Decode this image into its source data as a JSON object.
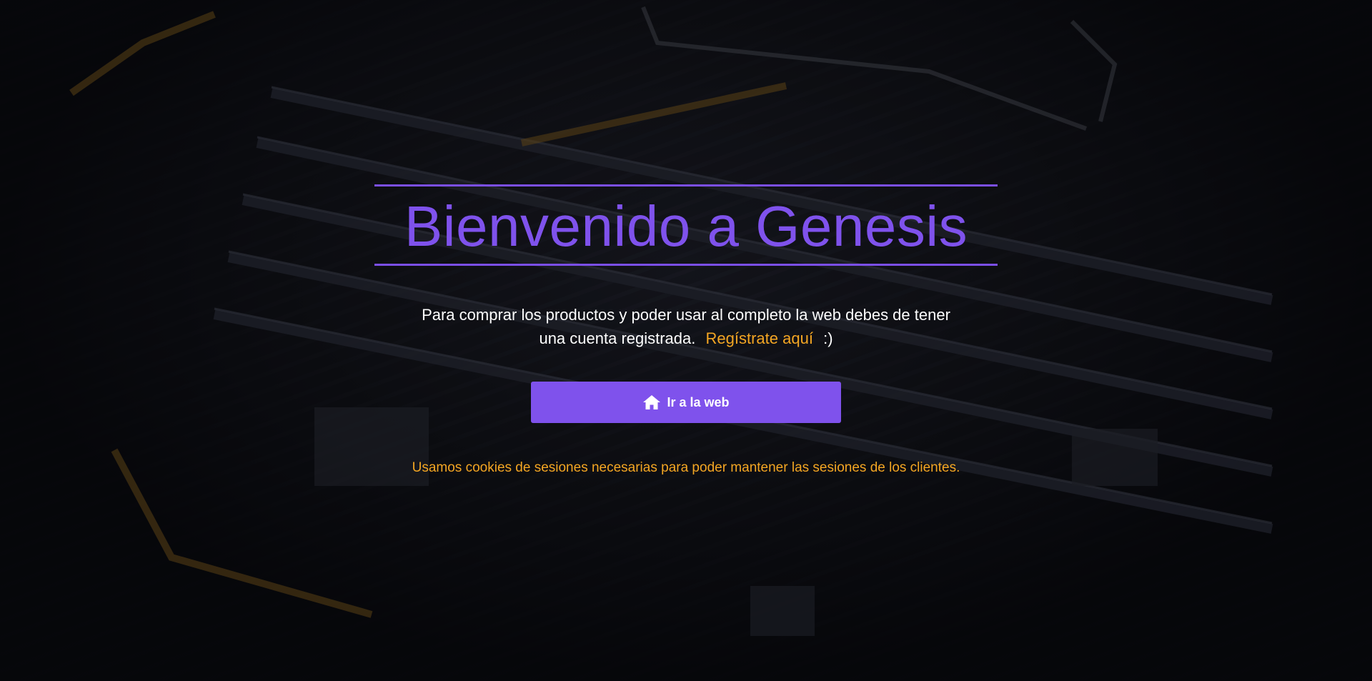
{
  "hero": {
    "title": "Bienvenido a Genesis",
    "message_line1": "Para comprar los productos y poder usar al completo la web debes de tener",
    "message_line2": "una cuenta registrada.",
    "register_link": "Regístrate aquí",
    "smiley": ":)",
    "cta_label": "Ir a la web",
    "cta_icon": "home-icon",
    "cookies_notice": "Usamos cookies de sesiones necesarias para poder mantener las sesiones de los clientes."
  },
  "colors": {
    "accent": "#7f52ec",
    "link": "#f4a623",
    "text": "#ffffff"
  }
}
